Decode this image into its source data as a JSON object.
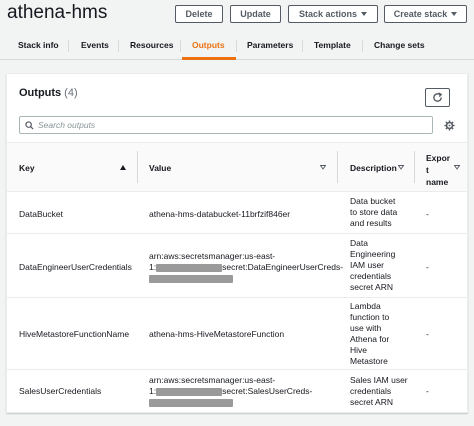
{
  "header": {
    "title": "athena-hms",
    "buttons": {
      "delete": "Delete",
      "update": "Update",
      "stack_actions": "Stack actions",
      "create_stack": "Create stack"
    }
  },
  "tabs": [
    {
      "label": "Stack info",
      "active": false
    },
    {
      "label": "Events",
      "active": false
    },
    {
      "label": "Resources",
      "active": false
    },
    {
      "label": "Outputs",
      "active": true
    },
    {
      "label": "Parameters",
      "active": false
    },
    {
      "label": "Template",
      "active": false
    },
    {
      "label": "Change sets",
      "active": false
    }
  ],
  "outputs": {
    "title": "Outputs",
    "count": "(4)",
    "search_placeholder": "Search outputs",
    "columns": {
      "key": "Key",
      "value": "Value",
      "description": "Description",
      "export_name_1": "Expor",
      "export_name_2": "t",
      "export_name_3": "name"
    },
    "rows": [
      {
        "key": "DataBucket",
        "value_lines": [
          "athena-hms-databucket-11brfzif846er"
        ],
        "description_lines": [
          "Data bucket",
          "to store data",
          "and results"
        ],
        "export": "-"
      },
      {
        "key": "DataEngineerUserCredentials",
        "value_lines": [
          "arn:aws:secretsmanager:us-east-",
          "1:",
          "secret:DataEngineerUserCreds-"
        ],
        "description_lines": [
          "Data",
          "Engineering",
          "IAM user",
          "credentials",
          "secret ARN"
        ],
        "export": "-"
      },
      {
        "key": "HiveMetastoreFunctionName",
        "value_lines": [
          "athena-hms-HiveMetastoreFunction"
        ],
        "description_lines": [
          "Lambda",
          "function to",
          "use with",
          "Athena for",
          "Hive",
          "Metastore"
        ],
        "export": "-"
      },
      {
        "key": "SalesUserCredentials",
        "value_lines": [
          "arn:aws:secretsmanager:us-east-",
          "1:",
          "secret:SalesUserCreds-"
        ],
        "description_lines": [
          "Sales IAM user",
          "credentials",
          "secret ARN"
        ],
        "export": "-"
      }
    ]
  },
  "colors": {
    "accent": "#ec7211",
    "border": "#545b64",
    "background": "#f2f3f3"
  }
}
